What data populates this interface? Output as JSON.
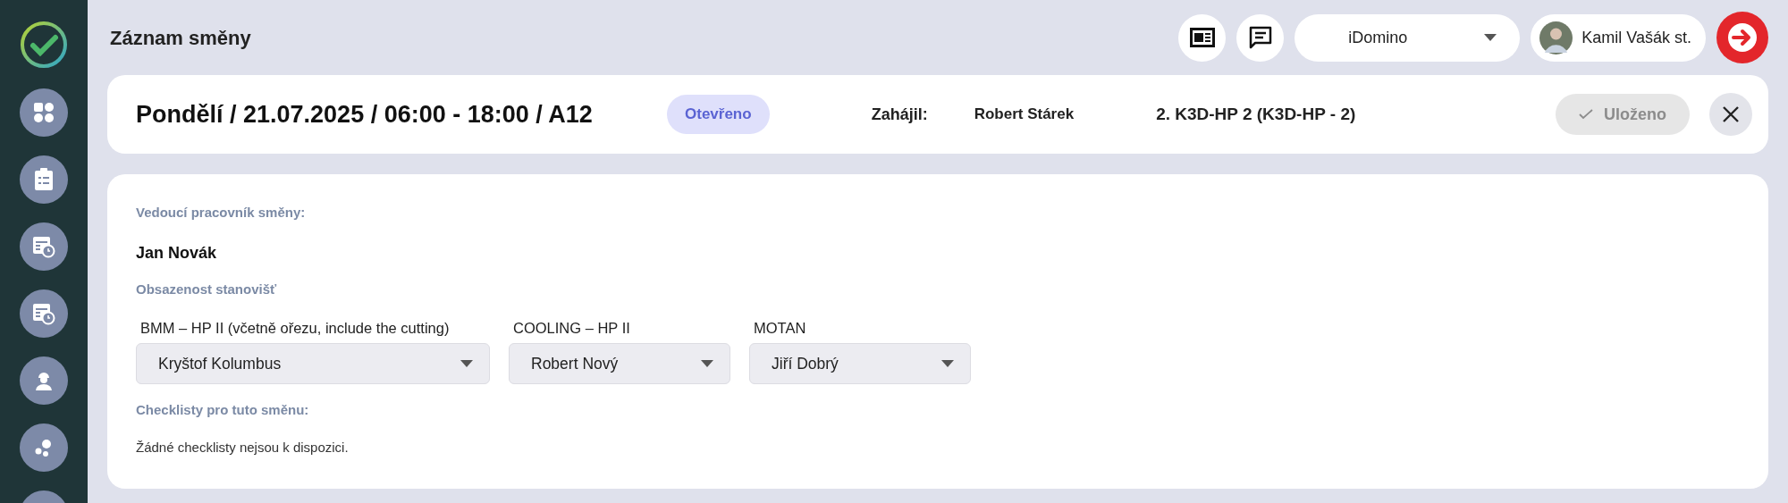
{
  "sidebar": {
    "items": [
      {
        "kind": "grid"
      },
      {
        "kind": "clipboard"
      },
      {
        "kind": "schedule"
      },
      {
        "kind": "calendar"
      },
      {
        "kind": "worker"
      },
      {
        "kind": "dots"
      },
      {
        "kind": "blank"
      }
    ]
  },
  "header": {
    "title": "Záznam směny",
    "workspace": {
      "value": "iDomino"
    },
    "user": {
      "name": "Kamil Vašák st."
    }
  },
  "shift": {
    "title": "Pondělí / 21.07.2025 / 06:00 - 18:00 / A12",
    "status": "Otevřeno",
    "started_label": "Zahájil:",
    "started_by": "Robert Stárek",
    "machine": "2. K3D-HP 2 (K3D-HP - 2)",
    "save_button": {
      "label": "Uloženo",
      "disabled": true
    }
  },
  "details": {
    "leader_label": "Vedoucí pracovník směny:",
    "leader": "Jan Novák",
    "stations_label": "Obsazenost stanovišť",
    "stations": [
      {
        "label": "BMM – HP II (včetně ořezu, include the cutting)",
        "value": "Kryštof Kolumbus"
      },
      {
        "label": "COOLING – HP II",
        "value": "Robert Nový"
      },
      {
        "label": "MOTAN",
        "value": "Jiří Dobrý"
      }
    ],
    "checklists_label": "Checklisty pro tuto směnu:",
    "checklists_empty": "Žádné checklisty nejsou k dispozici."
  }
}
